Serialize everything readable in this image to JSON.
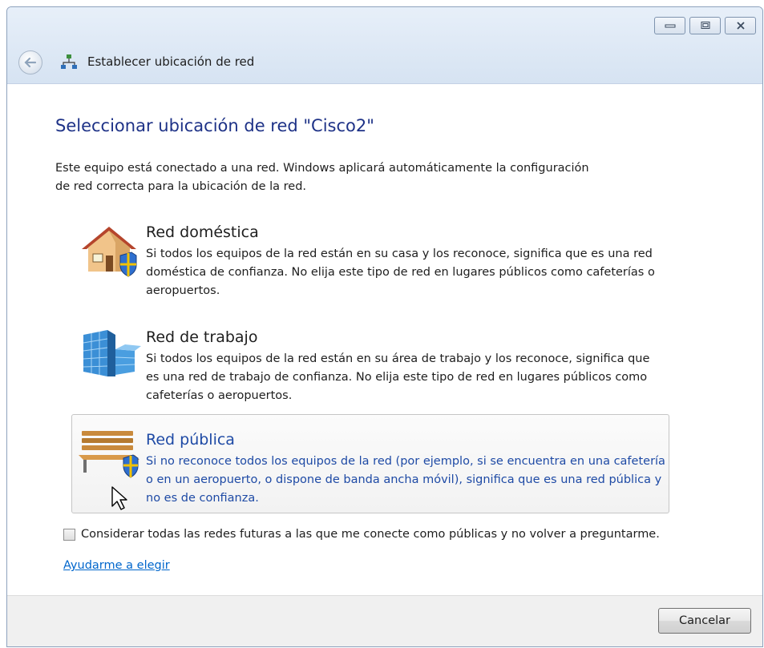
{
  "window": {
    "title": "Establecer ubicación de red",
    "caption_buttons": [
      "minimize",
      "maximize",
      "close"
    ]
  },
  "main": {
    "heading": "Seleccionar ubicación de red \"Cisco2\"",
    "intro": "Este equipo está conectado a una red. Windows aplicará automáticamente la configuración de red correcta para la ubicación de la red.",
    "options": [
      {
        "icon": "house-icon",
        "title": "Red doméstica",
        "description": "Si todos los equipos de la red están en su casa y los reconoce, significa que es una red doméstica de confianza. No elija este tipo de red en lugares públicos como cafeterías o aeropuertos."
      },
      {
        "icon": "office-building-icon",
        "title": "Red de trabajo",
        "description": "Si todos los equipos de la red están en su área de trabajo y los reconoce, significa que es una red de trabajo de confianza. No elija este tipo de red en lugares públicos como cafeterías o aeropuertos."
      },
      {
        "icon": "park-bench-icon",
        "title": "Red pública",
        "description": "Si no reconoce todos los equipos de la red (por ejemplo, si se encuentra en una cafetería o en un aeropuerto, o dispone de banda ancha móvil), significa que es una red pública y no es de confianza.",
        "highlighted": true
      }
    ],
    "checkbox": {
      "label": "Considerar todas las redes futuras a las que me conecte como públicas y no volver a preguntarme.",
      "checked": false
    },
    "help_link": "Ayudarme a elegir"
  },
  "footer": {
    "cancel_label": "Cancelar"
  },
  "colors": {
    "heading": "#1e3287",
    "highlight_text": "#1e4aa5",
    "link": "#0066cc"
  }
}
